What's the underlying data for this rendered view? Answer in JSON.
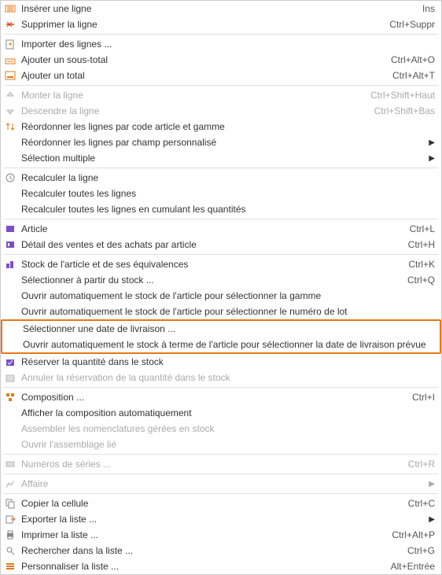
{
  "menu": {
    "insert_line": "Insérer une ligne",
    "insert_line_sc": "Ins",
    "delete_line": "Supprimer la ligne",
    "delete_line_sc": "Ctrl+Suppr",
    "import_lines": "Importer des lignes ...",
    "add_subtotal": "Ajouter un sous-total",
    "add_subtotal_sc": "Ctrl+Alt+O",
    "add_total": "Ajouter un total",
    "add_total_sc": "Ctrl+Alt+T",
    "move_up": "Monter la ligne",
    "move_up_sc": "Ctrl+Shift+Haut",
    "move_down": "Descendre la ligne",
    "move_down_sc": "Ctrl+Shift+Bas",
    "reorder_code": "Réordonner les lignes par code article et gamme",
    "reorder_custom": "Réordonner les lignes par champ personnalisé",
    "multi_select": "Sélection multiple",
    "recalc_line": "Recalculer la ligne",
    "recalc_all": "Recalculer toutes les lignes",
    "recalc_cum": "Recalculer toutes les lignes en cumulant les quantités",
    "article": "Article",
    "article_sc": "Ctrl+L",
    "detail_sales": "Détail des ventes et des achats par article",
    "detail_sales_sc": "Ctrl+H",
    "stock_equiv": "Stock de l'article et de ses équivalences",
    "stock_equiv_sc": "Ctrl+K",
    "select_stock": "Sélectionner à partir du stock ...",
    "select_stock_sc": "Ctrl+Q",
    "auto_stock_gamme": "Ouvrir automatiquement le stock de l'article pour sélectionner la gamme",
    "auto_stock_lot": "Ouvrir automatiquement le stock de l'article pour sélectionner le numéro de lot",
    "select_delivery": "Sélectionner une date de livraison ...",
    "auto_stock_delivery": "Ouvrir automatiquement le stock à terme de l'article pour sélectionner la date de livraison prévue",
    "reserve_qty": "Réserver la quantité dans le stock",
    "cancel_reserve": "Annuler la réservation de la quantité dans le stock",
    "composition": "Composition ...",
    "composition_sc": "Ctrl+I",
    "show_comp": "Afficher la composition automatiquement",
    "assemble_nom": "Assembler les nomenclatures gérées en stock",
    "open_assembly": "Ouvrir l'assemblage lié",
    "serial_numbers": "Numéros de séries ...",
    "serial_numbers_sc": "Ctrl+R",
    "affair": "Affaire",
    "copy_cell": "Copier la cellule",
    "copy_cell_sc": "Ctrl+C",
    "export_list": "Exporter la liste ...",
    "print_list": "Imprimer la liste ...",
    "print_list_sc": "Ctrl+Alt+P",
    "search_list": "Rechercher dans la liste ...",
    "search_list_sc": "Ctrl+G",
    "customize_list": "Personnaliser la liste ...",
    "customize_list_sc": "Alt+Entrée"
  }
}
